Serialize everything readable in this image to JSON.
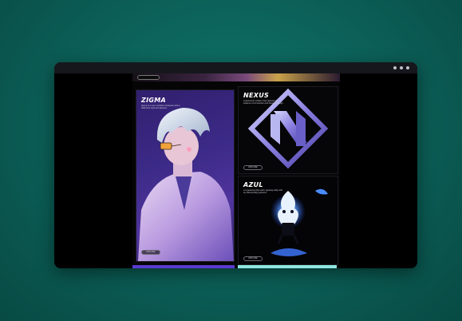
{
  "window": {
    "controls": [
      "minimize",
      "maximize",
      "close"
    ]
  },
  "gallery": {
    "cards": [
      {
        "title": "ZIGMA",
        "description": "Zigma is a cool, confident character with a distinctive style and glasses.",
        "button": "EXPLORE"
      },
      {
        "title": "NEXUS",
        "description": "A geometric emblem that captures the essence of connection and futuristic design.",
        "button": "EXPLORE"
      },
      {
        "title": "AZUL",
        "description": "A mysterious blue spirit, glowing softly with an otherworldly presence.",
        "button": "EXPLORE"
      }
    ]
  },
  "colors": {
    "background": "#0b5e56",
    "window": "#000000",
    "accent_purple": "#5b3ad0",
    "accent_cyan": "#8fe6e0"
  }
}
